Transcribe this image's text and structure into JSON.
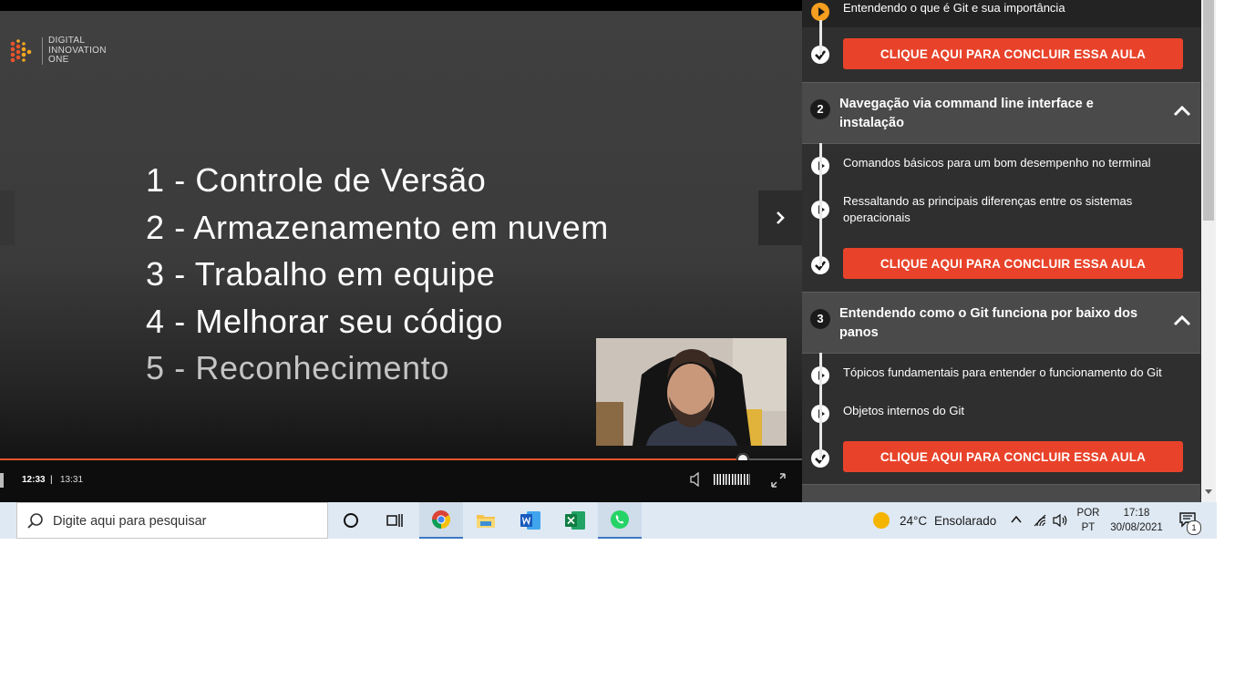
{
  "video": {
    "logo": {
      "line1": "DIGITAL",
      "line2": "INNOVATION",
      "line3": "ONE"
    },
    "topics": [
      "1 - Controle de Versão",
      "2 - Armazenamento em nuvem",
      "3 - Trabalho em equipe",
      "4 - Melhorar seu código",
      "5 - Reconhecimento"
    ],
    "time_current": "12:33",
    "time_separator": "|",
    "time_total": "13:31",
    "progress_fraction": 0.926,
    "accent_color": "#e8542b"
  },
  "sidebar": {
    "intro_lesson": "Entendendo o que é Git e sua importância",
    "cta_label": "CLIQUE AQUI PARA CONCLUIR ESSA AULA",
    "cta_color": "#e8432a",
    "modules": [
      {
        "number": "2",
        "title": "Navegação via command line interface e instalação",
        "lessons": [
          "Comandos básicos para um bom desempenho no terminal",
          "Ressaltando as principais diferenças entre os sistemas operacionais"
        ]
      },
      {
        "number": "3",
        "title": "Entendendo como o Git funciona por baixo dos panos",
        "lessons": [
          "Tópicos fundamentais para entender o funcionamento do Git",
          "Objetos internos do Git"
        ]
      }
    ]
  },
  "taskbar": {
    "search_placeholder": "Digite aqui para pesquisar",
    "apps": [
      "cortana-icon",
      "task-view-icon",
      "chrome-icon",
      "file-explorer-icon",
      "word-icon",
      "excel-icon",
      "whatsapp-icon"
    ],
    "weather_temp": "24°C",
    "weather_desc": "Ensolarado",
    "lang_line1": "POR",
    "lang_line2": "PT",
    "time": "17:18",
    "date": "30/08/2021",
    "notification_count": "1"
  }
}
